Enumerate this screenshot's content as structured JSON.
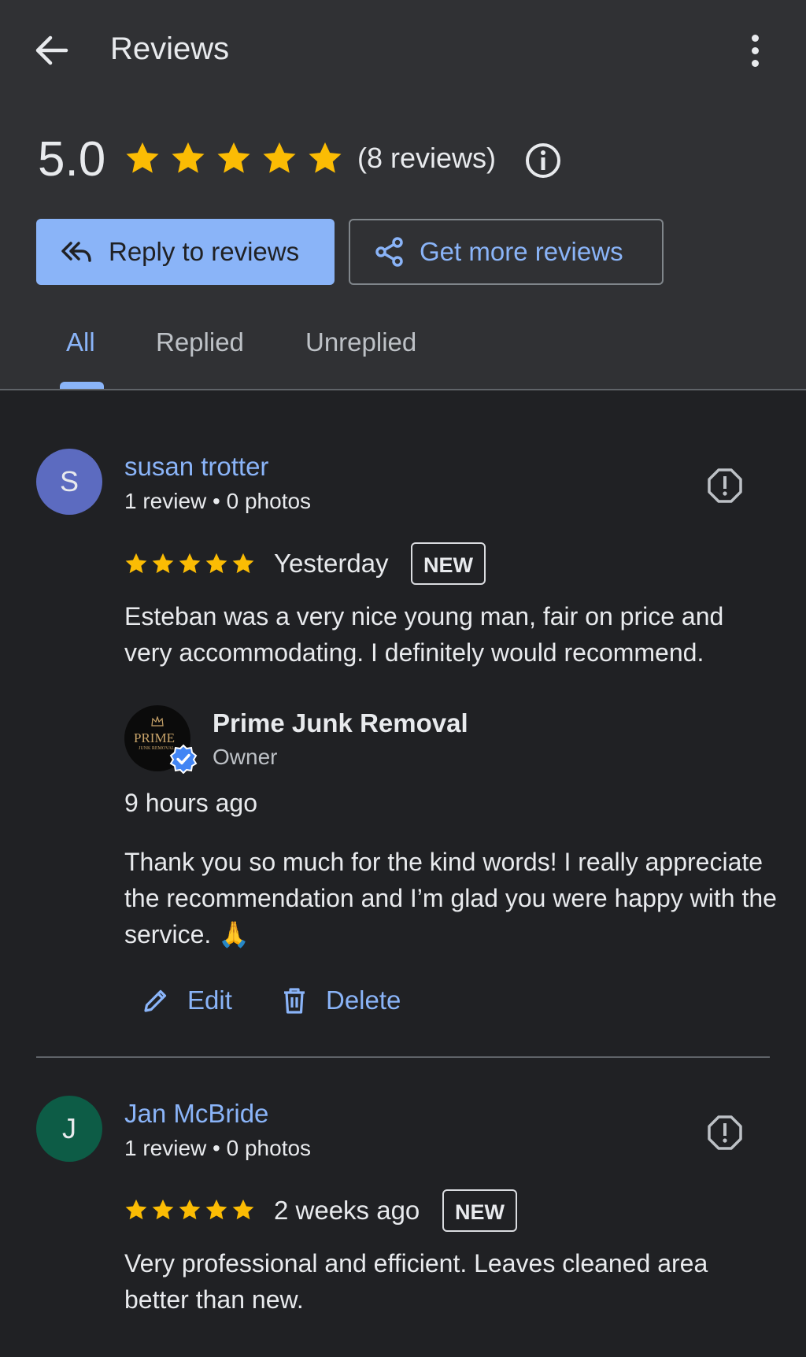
{
  "header": {
    "title": "Reviews",
    "rating": "5.0",
    "review_count": "(8 reviews)",
    "reply_button": "Reply to reviews",
    "more_button": "Get more reviews",
    "tabs": [
      "All",
      "Replied",
      "Unreplied"
    ]
  },
  "colors": {
    "accent": "#8ab4f8",
    "star": "#fbbc04",
    "background": "#202124",
    "header_background": "#303134"
  },
  "reviews": [
    {
      "initial": "S",
      "avatar_color": "#5c6bc0",
      "name": "susan trotter",
      "meta": "1 review • 0 photos",
      "rating": 5,
      "date": "Yesterday",
      "badge": "NEW",
      "text": "Esteban was a very nice young man, fair on price and very accommodating. I definitely would recommend.",
      "reply": {
        "owner_name": "Prime Junk Removal",
        "owner_role": "Owner",
        "logo_text": "PRIME",
        "logo_subtext": "JUNK REMOVAL",
        "time": "9 hours ago",
        "text": "Thank you so much for the kind words! I really appreciate the recommendation and I’m glad you were happy with the service. 🙏",
        "edit_label": "Edit",
        "delete_label": "Delete"
      }
    },
    {
      "initial": "J",
      "avatar_color": "#0d5c46",
      "name": "Jan McBride",
      "meta": "1 review • 0 photos",
      "rating": 5,
      "date": "2 weeks ago",
      "badge": "NEW",
      "text": "Very professional and efficient. Leaves cleaned area better than new."
    }
  ]
}
